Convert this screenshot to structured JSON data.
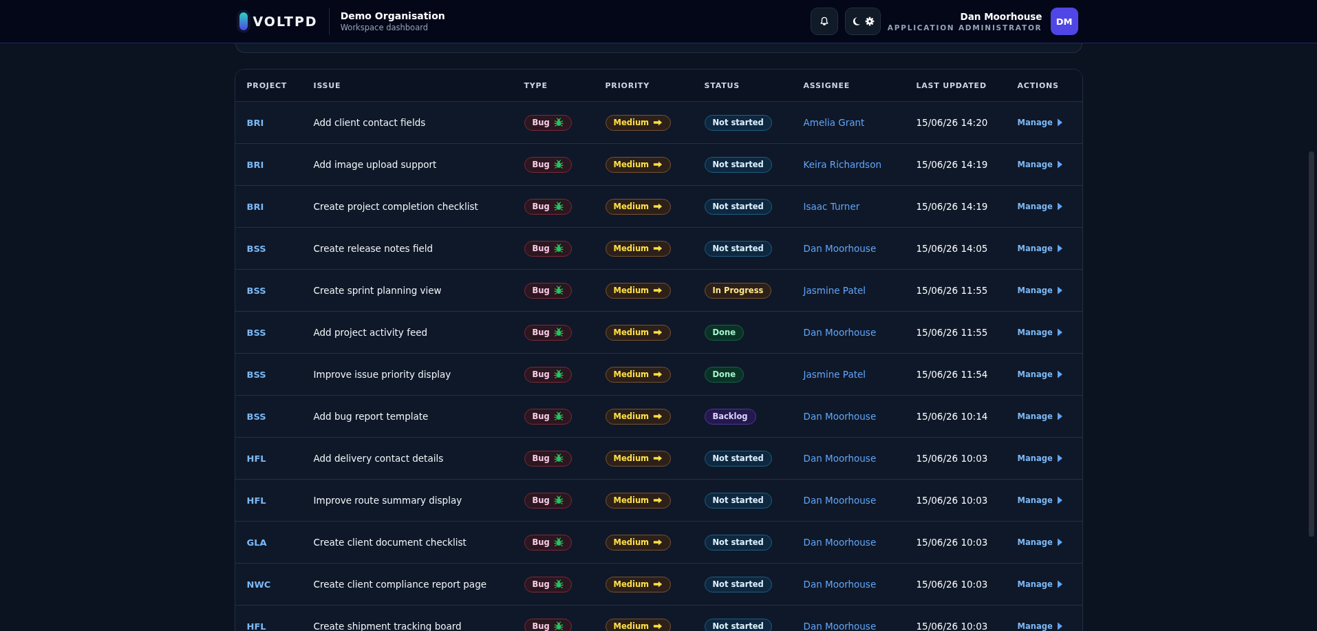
{
  "header": {
    "logo": "VOLTPD",
    "organisation": "Demo Organisation",
    "subtitle": "Workspace dashboard",
    "user": {
      "name": "Dan Moorhouse",
      "role": "APPLICATION ADMINISTRATOR",
      "initials": "DM"
    }
  },
  "table": {
    "columns": [
      "PROJECT",
      "ISSUE",
      "TYPE",
      "PRIORITY",
      "STATUS",
      "ASSIGNEE",
      "LAST UPDATED",
      "ACTIONS"
    ],
    "rows": [
      {
        "project": "BRI",
        "issue": "Add client contact fields",
        "type": {
          "label": "Bug",
          "kind": "bug"
        },
        "priority": {
          "label": "Medium",
          "kind": "medium"
        },
        "status": {
          "label": "Not started",
          "kind": "not_started"
        },
        "assignee": "Amelia Grant",
        "updated": "15/06/26 14:20",
        "action": "Manage"
      },
      {
        "project": "BRI",
        "issue": "Add image upload support",
        "type": {
          "label": "Bug",
          "kind": "bug"
        },
        "priority": {
          "label": "Medium",
          "kind": "medium"
        },
        "status": {
          "label": "Not started",
          "kind": "not_started"
        },
        "assignee": "Keira Richardson",
        "updated": "15/06/26 14:19",
        "action": "Manage"
      },
      {
        "project": "BRI",
        "issue": "Create project completion checklist",
        "type": {
          "label": "Bug",
          "kind": "bug"
        },
        "priority": {
          "label": "Medium",
          "kind": "medium"
        },
        "status": {
          "label": "Not started",
          "kind": "not_started"
        },
        "assignee": "Isaac Turner",
        "updated": "15/06/26 14:19",
        "action": "Manage"
      },
      {
        "project": "BSS",
        "issue": "Create release notes field",
        "type": {
          "label": "Bug",
          "kind": "bug"
        },
        "priority": {
          "label": "Medium",
          "kind": "medium"
        },
        "status": {
          "label": "Not started",
          "kind": "not_started"
        },
        "assignee": "Dan Moorhouse",
        "updated": "15/06/26 14:05",
        "action": "Manage"
      },
      {
        "project": "BSS",
        "issue": "Create sprint planning view",
        "type": {
          "label": "Bug",
          "kind": "bug"
        },
        "priority": {
          "label": "Medium",
          "kind": "medium"
        },
        "status": {
          "label": "In Progress",
          "kind": "in_progress"
        },
        "assignee": "Jasmine Patel",
        "updated": "15/06/26 11:55",
        "action": "Manage"
      },
      {
        "project": "BSS",
        "issue": "Add project activity feed",
        "type": {
          "label": "Bug",
          "kind": "bug"
        },
        "priority": {
          "label": "Medium",
          "kind": "medium"
        },
        "status": {
          "label": "Done",
          "kind": "done"
        },
        "assignee": "Dan Moorhouse",
        "updated": "15/06/26 11:55",
        "action": "Manage"
      },
      {
        "project": "BSS",
        "issue": "Improve issue priority display",
        "type": {
          "label": "Bug",
          "kind": "bug"
        },
        "priority": {
          "label": "Medium",
          "kind": "medium"
        },
        "status": {
          "label": "Done",
          "kind": "done"
        },
        "assignee": "Jasmine Patel",
        "updated": "15/06/26 11:54",
        "action": "Manage"
      },
      {
        "project": "BSS",
        "issue": "Add bug report template",
        "type": {
          "label": "Bug",
          "kind": "bug"
        },
        "priority": {
          "label": "Medium",
          "kind": "medium"
        },
        "status": {
          "label": "Backlog",
          "kind": "backlog"
        },
        "assignee": "Dan Moorhouse",
        "updated": "15/06/26 10:14",
        "action": "Manage"
      },
      {
        "project": "HFL",
        "issue": "Add delivery contact details",
        "type": {
          "label": "Bug",
          "kind": "bug"
        },
        "priority": {
          "label": "Medium",
          "kind": "medium"
        },
        "status": {
          "label": "Not started",
          "kind": "not_started"
        },
        "assignee": "Dan Moorhouse",
        "updated": "15/06/26 10:03",
        "action": "Manage"
      },
      {
        "project": "HFL",
        "issue": "Improve route summary display",
        "type": {
          "label": "Bug",
          "kind": "bug"
        },
        "priority": {
          "label": "Medium",
          "kind": "medium"
        },
        "status": {
          "label": "Not started",
          "kind": "not_started"
        },
        "assignee": "Dan Moorhouse",
        "updated": "15/06/26 10:03",
        "action": "Manage"
      },
      {
        "project": "GLA",
        "issue": "Create client document checklist",
        "type": {
          "label": "Bug",
          "kind": "bug"
        },
        "priority": {
          "label": "Medium",
          "kind": "medium"
        },
        "status": {
          "label": "Not started",
          "kind": "not_started"
        },
        "assignee": "Dan Moorhouse",
        "updated": "15/06/26 10:03",
        "action": "Manage"
      },
      {
        "project": "NWC",
        "issue": "Create client compliance report page",
        "type": {
          "label": "Bug",
          "kind": "bug"
        },
        "priority": {
          "label": "Medium",
          "kind": "medium"
        },
        "status": {
          "label": "Not started",
          "kind": "not_started"
        },
        "assignee": "Dan Moorhouse",
        "updated": "15/06/26 10:03",
        "action": "Manage"
      },
      {
        "project": "HFL",
        "issue": "Create shipment tracking board",
        "type": {
          "label": "Bug",
          "kind": "bug"
        },
        "priority": {
          "label": "Medium",
          "kind": "medium"
        },
        "status": {
          "label": "Not started",
          "kind": "not_started"
        },
        "assignee": "Dan Moorhouse",
        "updated": "15/06/26 10:03",
        "action": "Manage"
      }
    ]
  }
}
